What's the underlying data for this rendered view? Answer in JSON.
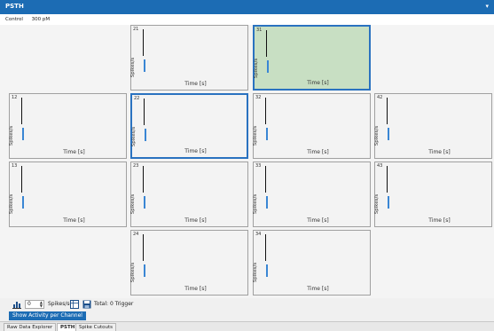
{
  "window": {
    "title": "PSTH",
    "collapse_glyph": "▾"
  },
  "filters": {
    "item1": "Control",
    "item2": "300 pM"
  },
  "panels": [
    {
      "channel": "21",
      "ylabel": "Spikes/s",
      "xlabel": "Time [s]"
    },
    {
      "channel": "31",
      "ylabel": "Spikes/s",
      "xlabel": "Time [s]"
    },
    {
      "channel": "12",
      "ylabel": "Spikes/s",
      "xlabel": "Time [s]"
    },
    {
      "channel": "22",
      "ylabel": "Spikes/s",
      "xlabel": "Time [s]"
    },
    {
      "channel": "32",
      "ylabel": "Spikes/s",
      "xlabel": "Time [s]"
    },
    {
      "channel": "42",
      "ylabel": "Spikes/s",
      "xlabel": "Time [s]"
    },
    {
      "channel": "13",
      "ylabel": "Spikes/s",
      "xlabel": "Time [s]"
    },
    {
      "channel": "23",
      "ylabel": "Spikes/s",
      "xlabel": "Time [s]"
    },
    {
      "channel": "33",
      "ylabel": "Spikes/s",
      "xlabel": "Time [s]"
    },
    {
      "channel": "43",
      "ylabel": "Spikes/s",
      "xlabel": "Time [s]"
    },
    {
      "channel": "24",
      "ylabel": "Spikes/s",
      "xlabel": "Time [s]"
    },
    {
      "channel": "34",
      "ylabel": "Spikes/s",
      "xlabel": "Time [s]"
    }
  ],
  "toolbar": {
    "spin_value": "0",
    "spin_unit": "Spikes/sec",
    "trigger_text": "Total: 0 Trigger"
  },
  "show_activity_label": "Show Activity per Channel",
  "tabs": [
    "Raw Data Explorer",
    "PSTH",
    "Spike Cutouts"
  ],
  "colors": {
    "accent": "#1c6cb4",
    "selected_border": "#2a72c0",
    "active_panel_bg": "#c8dfc3",
    "marker_blue": "#3a86d4"
  }
}
